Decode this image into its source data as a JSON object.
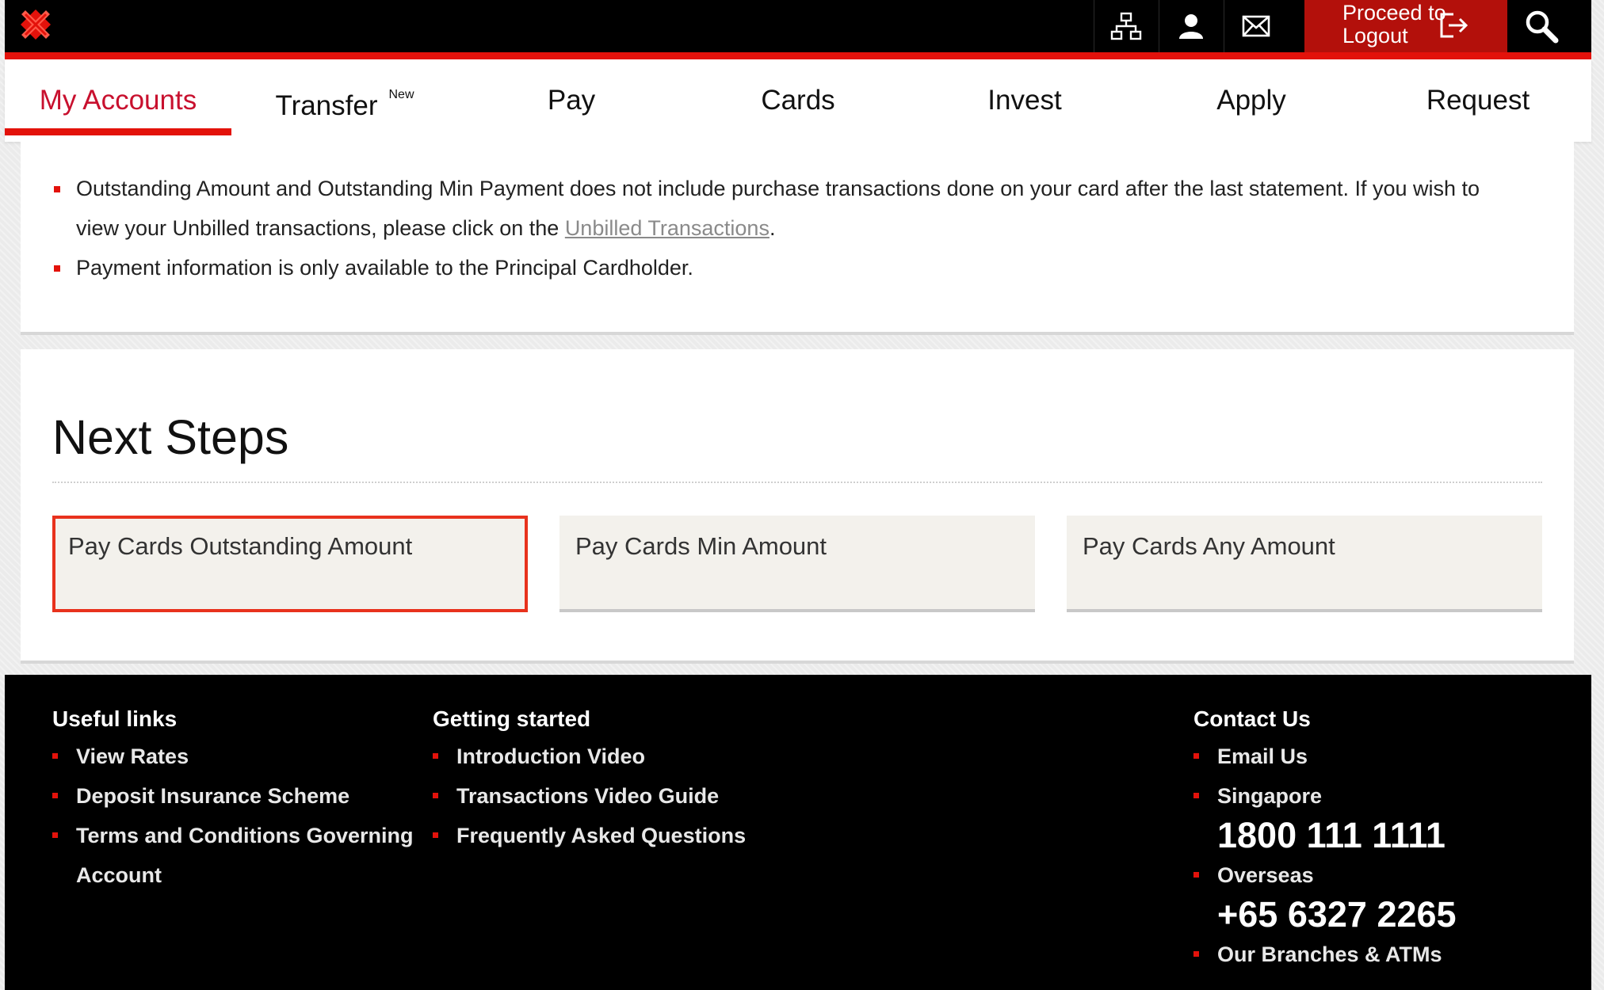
{
  "header": {
    "logout_line1": "Proceed to",
    "logout_line2": "Logout",
    "icons": [
      "sitemap-icon",
      "user-icon",
      "mail-icon",
      "logout-icon",
      "search-icon"
    ],
    "brand_color": "#e3120b"
  },
  "nav": {
    "items": [
      {
        "label": "My Accounts",
        "active": true
      },
      {
        "label": "Transfer",
        "badge": "New"
      },
      {
        "label": "Pay"
      },
      {
        "label": "Cards"
      },
      {
        "label": "Invest"
      },
      {
        "label": "Apply"
      },
      {
        "label": "Request"
      }
    ]
  },
  "notes": {
    "item1_text": "Outstanding Amount and Outstanding Min Payment does not include purchase transactions done on your card after the last statement. If you wish to view your Unbilled transactions, please click on the ",
    "item1_link": "Unbilled Transactions",
    "item1_end": ".",
    "item2_text": "Payment information is only available to the Principal Cardholder."
  },
  "next_steps": {
    "title": "Next Steps",
    "cards": [
      {
        "label": "Pay Cards Outstanding Amount",
        "selected": true
      },
      {
        "label": "Pay Cards Min Amount"
      },
      {
        "label": "Pay Cards Any Amount"
      }
    ]
  },
  "footer": {
    "useful_links": {
      "title": "Useful links",
      "items": [
        "View Rates",
        "Deposit Insurance Scheme",
        "Terms and Conditions Governing",
        "Account"
      ]
    },
    "getting_started": {
      "title": "Getting started",
      "items": [
        "Introduction Video",
        "Transactions Video Guide",
        "Frequently Asked Questions"
      ]
    },
    "contact": {
      "title": "Contact Us",
      "email": "Email Us",
      "singapore_label": "Singapore",
      "singapore_phone": "1800 111 1111",
      "overseas_label": "Overseas",
      "overseas_phone": "+65 6327 2265",
      "branches": "Our Branches & ATMs"
    }
  }
}
